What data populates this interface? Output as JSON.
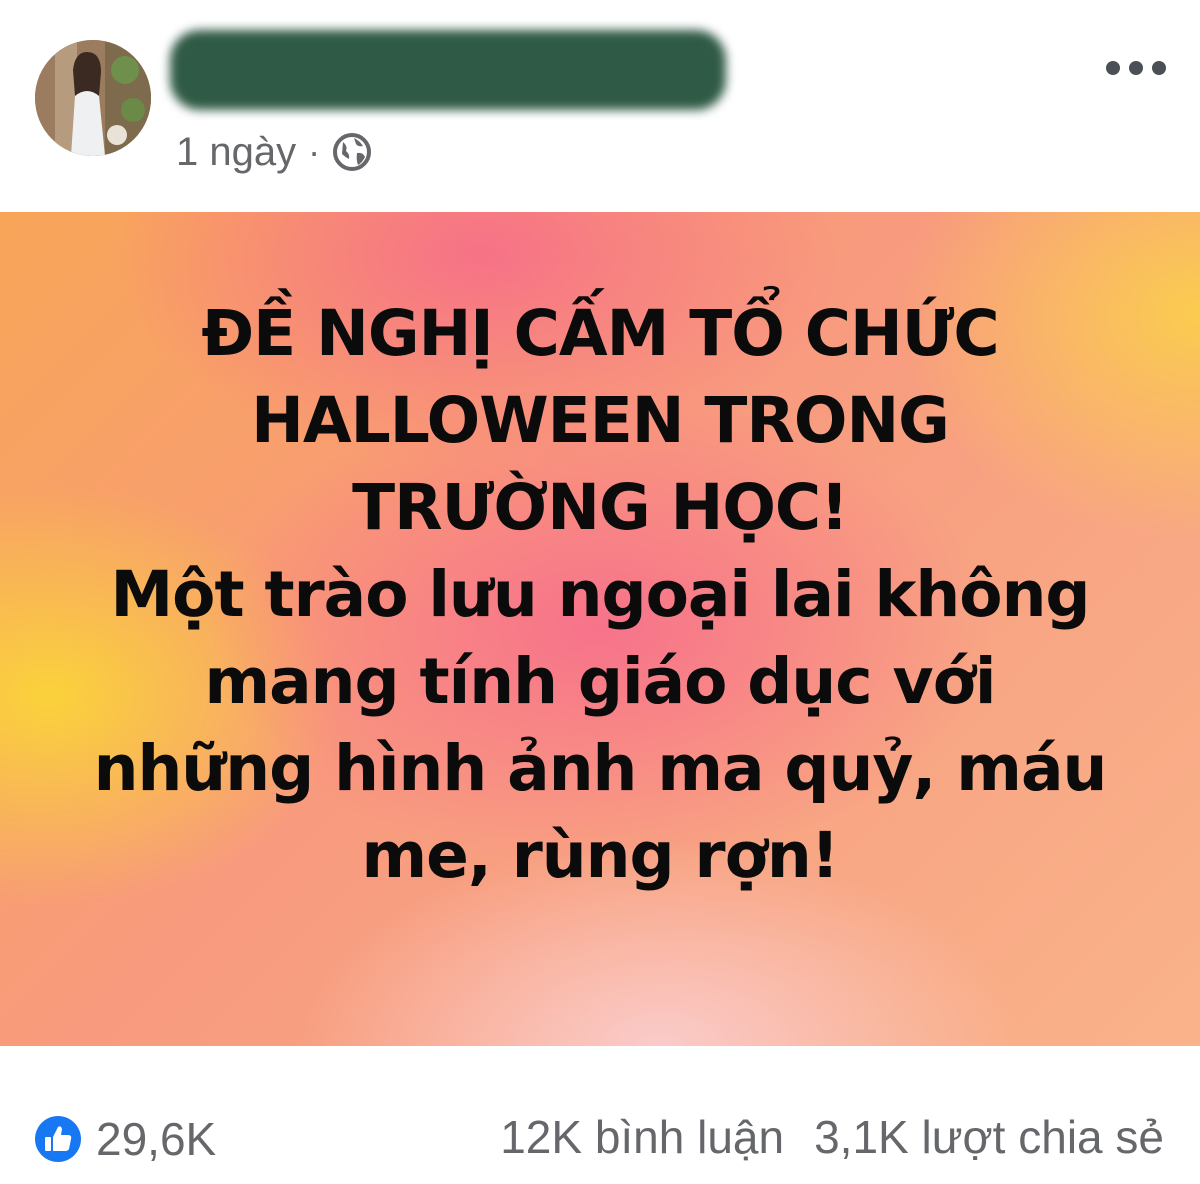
{
  "header": {
    "author_name_redacted": true,
    "timestamp": "1 ngày",
    "separator": "·",
    "audience_icon": "globe-icon",
    "more_icon": "more-horizontal-icon"
  },
  "status": {
    "lines": [
      "ĐỀ NGHỊ CẤM TỔ CHỨC",
      "HALLOWEEN TRONG",
      "TRƯỜNG HỌC!",
      "Một trào lưu ngoại lai không",
      "mang tính giáo dục với",
      "những hình ảnh ma quỷ, máu",
      "me, rùng rợn!"
    ],
    "background_colors": [
      "#f76e8c",
      "#fad538",
      "#f8a558",
      "#facdcd"
    ],
    "text_color": "#0b0b0b"
  },
  "footer": {
    "reaction_icon": "like-icon",
    "reaction_color": "#1877f2",
    "reactions_count": "29,6K",
    "comments": "12K bình luận",
    "shares": "3,1K lượt chia sẻ"
  }
}
